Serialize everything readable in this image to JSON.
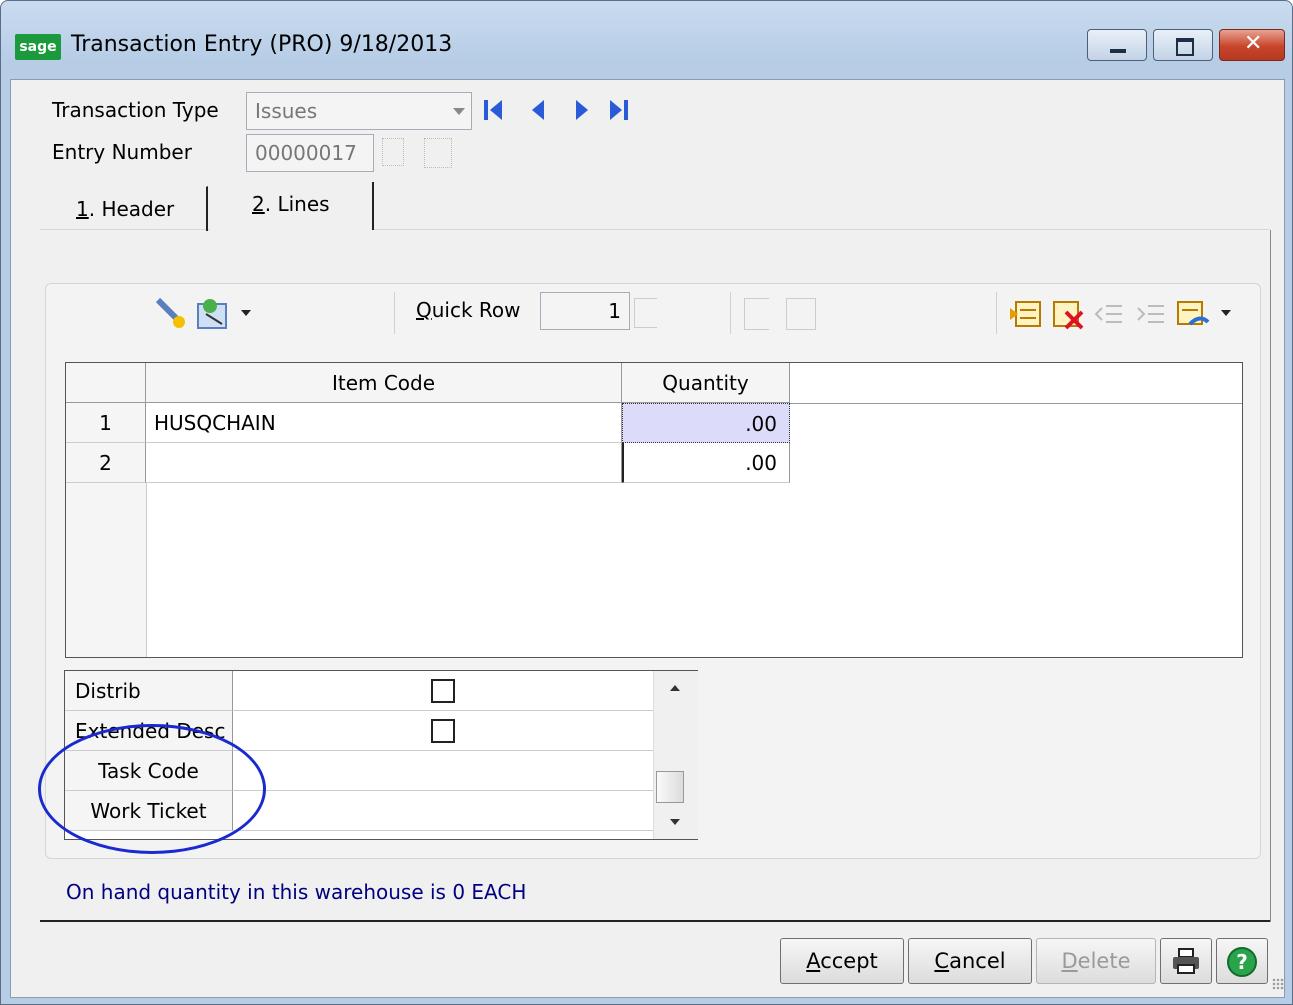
{
  "window": {
    "logo": "sage",
    "title": "Transaction Entry (PRO) 9/18/2013"
  },
  "form": {
    "transaction_type_label": "Transaction Type",
    "transaction_type_value": "Issues",
    "entry_number_label": "Entry Number",
    "entry_number_value": "00000017"
  },
  "tabs": [
    {
      "key": "1",
      "rest": ". Header"
    },
    {
      "key": "2",
      "rest": ". Lines"
    }
  ],
  "toolbar": {
    "quick_row_label_key": "Q",
    "quick_row_label_rest": "uick Row",
    "quick_row_value": "1"
  },
  "grid": {
    "columns": [
      "Item Code",
      "Quantity"
    ],
    "rows": [
      {
        "num": "1",
        "item_code": "HUSQCHAIN",
        "quantity": ".00"
      },
      {
        "num": "2",
        "item_code": "",
        "quantity": ".00"
      }
    ]
  },
  "properties": [
    {
      "label": "Distrib Required",
      "checked": false
    },
    {
      "label": "Extended Desc",
      "checked": false
    },
    {
      "label": "Task Code",
      "value": ""
    },
    {
      "label": "Work Ticket",
      "value": ""
    }
  ],
  "status_text": "On hand quantity in this warehouse is 0 EACH",
  "buttons": {
    "accept_key": "A",
    "accept_rest": "ccept",
    "cancel_key": "C",
    "cancel_rest": "ancel",
    "delete_key": "D",
    "delete_rest": "elete"
  },
  "annotation_color": "#1a2ad0"
}
